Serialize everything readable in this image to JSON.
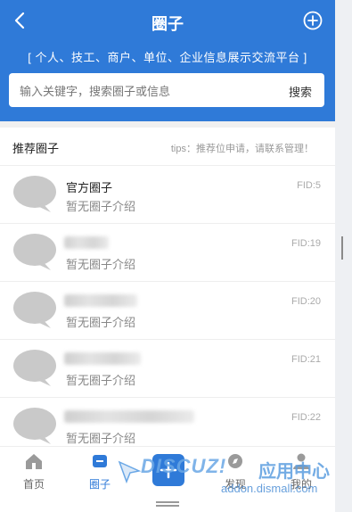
{
  "header": {
    "title": "圈子",
    "slogan": "[ 个人、技工、商户、单位、企业信息展示交流平台 ]"
  },
  "search": {
    "placeholder": "输入关键字，搜索圈子或信息",
    "button_label": "搜索"
  },
  "section": {
    "title": "推荐圈子",
    "tips": "tips：推荐位申请，请联系管理！"
  },
  "circles": [
    {
      "name": "官方圈子",
      "description": "暂无圈子介绍",
      "fid": "FID:5"
    },
    {
      "name": "",
      "description": "暂无圈子介绍",
      "fid": "FID:19",
      "blurred": true
    },
    {
      "name": "",
      "description": "暂无圈子介绍",
      "fid": "FID:20",
      "blurred": true
    },
    {
      "name": "",
      "description": "暂无圈子介绍",
      "fid": "FID:21",
      "blurred": true
    },
    {
      "name": "",
      "description": "暂无圈子介绍",
      "fid": "FID:22",
      "blurred": true
    }
  ],
  "tabbar": {
    "home": "首页",
    "circle": "圈子",
    "discover": "发现",
    "mine": "我的"
  },
  "watermark": {
    "logo": "DISCUZ!",
    "cn": "应用中心",
    "url": "addon.dismall.com"
  },
  "colors": {
    "primary": "#2f7ad8",
    "avatar_placeholder": "#c9c9c9"
  },
  "icons": [
    "back-arrow-icon",
    "add-circle-icon",
    "home-icon",
    "circle-icon",
    "discover-icon",
    "mine-icon"
  ]
}
